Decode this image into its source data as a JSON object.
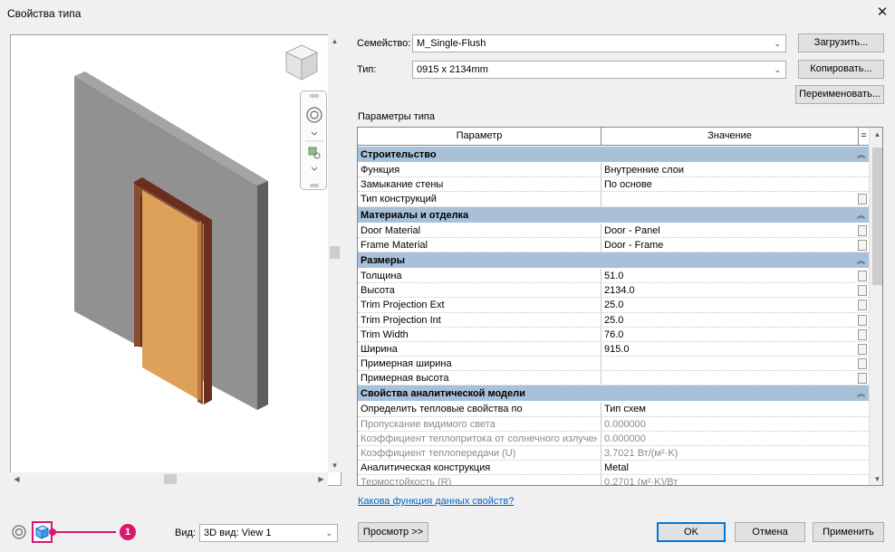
{
  "window": {
    "title": "Свойства типа",
    "close_glyph": "✕"
  },
  "family": {
    "label": "Семейство:",
    "value": "M_Single-Flush"
  },
  "type": {
    "label": "Тип:",
    "value": "0915 x 2134mm"
  },
  "buttons": {
    "load": "Загрузить...",
    "copy": "Копировать...",
    "rename": "Переименовать...",
    "preview": "Просмотр >>",
    "ok": "OK",
    "cancel": "Отмена",
    "apply": "Применить"
  },
  "params_title": "Параметры типа",
  "grid": {
    "col_param": "Параметр",
    "col_value": "Значение",
    "col_extra": "=",
    "rows": [
      {
        "kind": "group",
        "name": "Строительство"
      },
      {
        "kind": "row",
        "name": "Функция",
        "value": "Внутренние слои",
        "btn": false
      },
      {
        "kind": "row",
        "name": "Замыкание стены",
        "value": "По основе",
        "btn": false
      },
      {
        "kind": "row",
        "name": "Тип конструкций",
        "value": "",
        "btn": true
      },
      {
        "kind": "group",
        "name": "Материалы и отделка"
      },
      {
        "kind": "row",
        "name": "Door Material",
        "value": "Door - Panel",
        "btn": true
      },
      {
        "kind": "row",
        "name": "Frame Material",
        "value": "Door - Frame",
        "btn": true
      },
      {
        "kind": "group",
        "name": "Размеры"
      },
      {
        "kind": "row",
        "name": "Толщина",
        "value": "51.0",
        "btn": true
      },
      {
        "kind": "row",
        "name": "Высота",
        "value": "2134.0",
        "btn": true
      },
      {
        "kind": "row",
        "name": "Trim Projection Ext",
        "value": "25.0",
        "btn": true
      },
      {
        "kind": "row",
        "name": "Trim Projection Int",
        "value": "25.0",
        "btn": true
      },
      {
        "kind": "row",
        "name": "Trim Width",
        "value": "76.0",
        "btn": true
      },
      {
        "kind": "row",
        "name": "Ширина",
        "value": "915.0",
        "btn": true
      },
      {
        "kind": "row",
        "name": "Примерная ширина",
        "value": "",
        "btn": true
      },
      {
        "kind": "row",
        "name": "Примерная высота",
        "value": "",
        "btn": true
      },
      {
        "kind": "group",
        "name": "Свойства аналитической модели"
      },
      {
        "kind": "row",
        "name": "Определить тепловые свойства по",
        "value": "Тип схем",
        "btn": false
      },
      {
        "kind": "row",
        "name": "Пропускание видимого света",
        "value": "0.000000",
        "btn": false,
        "dim": true
      },
      {
        "kind": "row",
        "name": "Коэффициент теплопритока от солнечного излучения",
        "value": "0.000000",
        "btn": false,
        "dim": true
      },
      {
        "kind": "row",
        "name": "Коэффициент теплопередачи (U)",
        "value": "3.7021 Вт/(м²·K)",
        "btn": false,
        "dim": true
      },
      {
        "kind": "row",
        "name": "Аналитическая конструкция",
        "value": "Metal",
        "btn": false
      },
      {
        "kind": "row",
        "name": "Термостойкость (R)",
        "value": "0.2701 (м²·K)/Вт",
        "btn": false,
        "dim": true
      }
    ]
  },
  "help_link": "Какова функция данных свойств?",
  "view": {
    "label": "Вид:",
    "value": "3D вид: View 1"
  },
  "callout": {
    "number": "1"
  },
  "colors": {
    "group_bg": "#a8c1d9",
    "wall": "#919191",
    "door": "#dda15a",
    "frame": "#6b2e1c",
    "callout": "#d6186f"
  }
}
